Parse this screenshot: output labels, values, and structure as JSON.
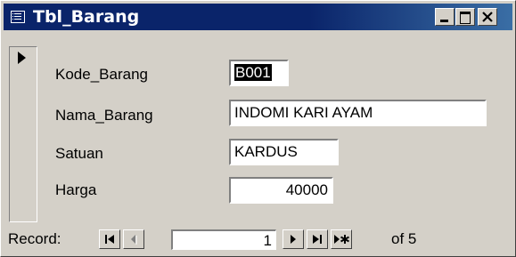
{
  "window": {
    "title": "Tbl_Barang",
    "icon": "form-icon",
    "buttons": [
      "minimize-icon",
      "maximize-icon",
      "close-icon"
    ]
  },
  "record_selector": {
    "icon": "current-record-arrow-icon"
  },
  "fields": [
    {
      "label": "Kode_Barang",
      "value": "B001",
      "selected": true
    },
    {
      "label": "Nama_Barang",
      "value": "INDOMI KARI AYAM"
    },
    {
      "label": "Satuan",
      "value": "KARDUS"
    },
    {
      "label": "Harga",
      "value": "40000"
    }
  ],
  "navigation": {
    "label": "Record:",
    "current": "1",
    "of_label": "of 5",
    "buttons": [
      "first-record-icon",
      "previous-record-icon",
      "next-record-icon",
      "last-record-icon",
      "new-record-icon"
    ]
  }
}
